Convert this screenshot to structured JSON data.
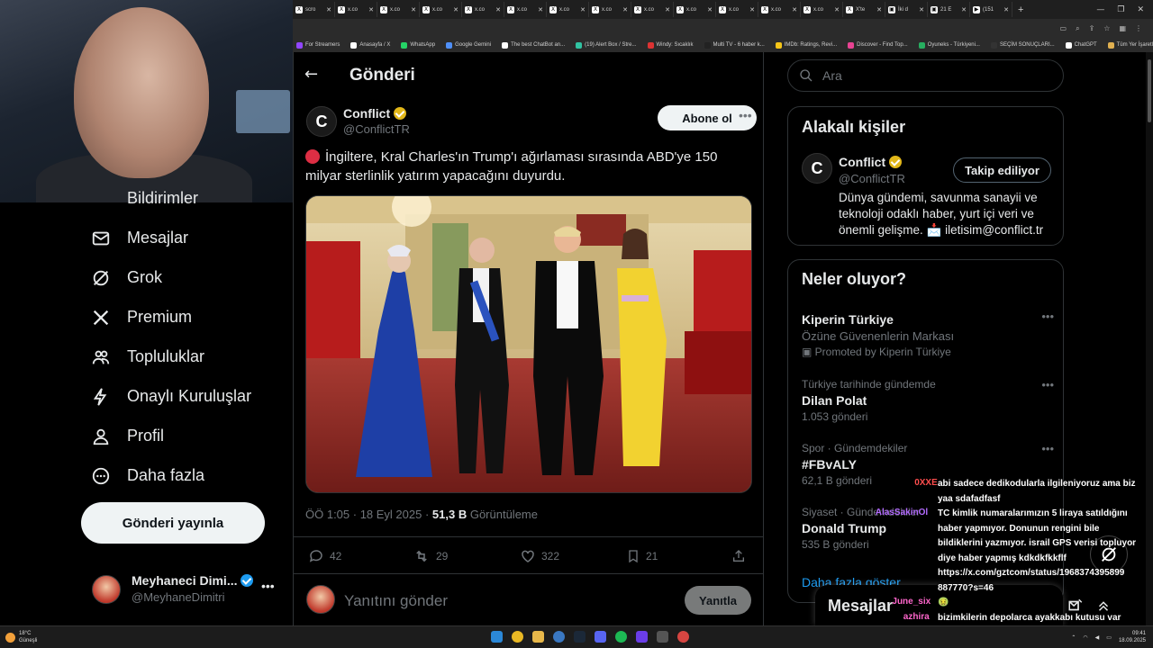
{
  "browser": {
    "tabs": [
      {
        "label": "scro",
        "fav": "X"
      },
      {
        "label": "x.co",
        "fav": "X"
      },
      {
        "label": "x.co",
        "fav": "X"
      },
      {
        "label": "x.co",
        "fav": "X"
      },
      {
        "label": "x.co",
        "fav": "X"
      },
      {
        "label": "x.co",
        "fav": "X"
      },
      {
        "label": "x.co",
        "fav": "X"
      },
      {
        "label": "x.co",
        "fav": "X"
      },
      {
        "label": "x.co",
        "fav": "X"
      },
      {
        "label": "x.co",
        "fav": "X"
      },
      {
        "label": "x.co",
        "fav": "X"
      },
      {
        "label": "x.co",
        "fav": "X"
      },
      {
        "label": "x.co",
        "fav": "X"
      },
      {
        "label": "X'te",
        "fav": "X"
      },
      {
        "label": "İki d",
        "fav": "▣"
      },
      {
        "label": "21 E",
        "fav": "▣"
      },
      {
        "label": "(151",
        "fav": "▶"
      }
    ],
    "bookmarks": [
      {
        "label": "For Streamers",
        "color": "#9146ff"
      },
      {
        "label": "Anasayfa / X",
        "color": "#ffffff"
      },
      {
        "label": "WhatsApp",
        "color": "#25d366"
      },
      {
        "label": "Google Gemini",
        "color": "#4f8ff7"
      },
      {
        "label": "The best ChatBot an...",
        "color": "#ffffff"
      },
      {
        "label": "(19) Alert Box / Stre...",
        "color": "#31c3a2"
      },
      {
        "label": "Windy: Sıcaklık",
        "color": "#d33"
      },
      {
        "label": "Multi TV - 6 haber k...",
        "color": "#222"
      },
      {
        "label": "IMDb: Ratings, Revi...",
        "color": "#f5c518"
      },
      {
        "label": "Discover - Find Top...",
        "color": "#e84393"
      },
      {
        "label": "Oyuneks - Türkiyeni...",
        "color": "#27ae60"
      },
      {
        "label": "SEÇİM SONUÇLARI...",
        "color": "#333"
      },
      {
        "label": "ChatGPT",
        "color": "#ffffff"
      },
      {
        "label": "Tüm Yer İşaretleri",
        "color": "#e0b050"
      }
    ]
  },
  "sidebar": {
    "items": [
      {
        "label": "Mesajlar",
        "icon": "envelope-icon"
      },
      {
        "label": "Grok",
        "icon": "grok-icon"
      },
      {
        "label": "Premium",
        "icon": "x-logo-icon"
      },
      {
        "label": "Topluluklar",
        "icon": "people-icon"
      },
      {
        "label": "Onaylı Kuruluşlar",
        "icon": "lightning-icon"
      },
      {
        "label": "Profil",
        "icon": "person-icon"
      },
      {
        "label": "Daha fazla",
        "icon": "more-circle-icon"
      }
    ],
    "partial_item": "Bildirimler",
    "post_button": "Gönderi yayınla",
    "profile": {
      "name": "Meyhaneci Dimi...",
      "handle": "@MeyhaneDimitri"
    }
  },
  "main": {
    "title": "Gönderi",
    "tweet": {
      "author": "Conflict",
      "handle": "@ConflictTR",
      "avatar_letter": "C",
      "follow_label": "Abone ol",
      "text": "İngiltere, Kral Charles'ın Trump'ı ağırlaması sırasında ABD'ye 150 milyar sterlinlik yatırım yapacağını duyurdu.",
      "time": "ÖÖ 1:05 · 18 Eyl 2025 · ",
      "views": "51,3 B",
      "views_label": " Görüntüleme",
      "replies": "42",
      "reposts": "29",
      "likes": "322",
      "bookmarks": "21"
    },
    "reply_placeholder": "Yanıtını gönder",
    "reply_button": "Yanıtla"
  },
  "right": {
    "search_placeholder": "Ara",
    "related": {
      "title": "Alakalı kişiler",
      "name": "Conflict",
      "handle": "@ConflictTR",
      "button": "Takip ediliyor",
      "bio": "Dünya gündemi, savunma sanayii ve teknoloji odaklı haber, yurt içi veri ve önemli gelişme. 📩 iletisim@conflict.tr"
    },
    "trends_title": "Neler oluyor?",
    "trends": [
      {
        "meta": "",
        "title": "Kiperin Türkiye",
        "sub": "Özüne Güvenenlerin Markası",
        "promo": "Promoted by Kiperin Türkiye"
      },
      {
        "meta": "Türkiye tarihinde gündemde",
        "title": "Dilan Polat",
        "sub": "1.053 gönderi"
      },
      {
        "meta": "Spor · Gündemdekiler",
        "title": "#FBvALY",
        "sub": "62,1 B gönderi"
      },
      {
        "meta": "Siyaset · Gündemdekiler",
        "title": "Donald Trump",
        "sub": "535 B gönderi"
      }
    ],
    "show_more": "Daha fazla göster",
    "messages_drawer": "Mesajlar"
  },
  "chat": [
    {
      "user": "0XXE",
      "user_color": "#ff4d4d",
      "text": "abi sadece dedikodularla ilgileniyoruz ama biz"
    },
    {
      "user": "",
      "user_color": "#ffffff",
      "text": "yaa sdafadfasf"
    },
    {
      "user": "AlasSakinOl",
      "user_color": "#b36bff",
      "text": "TC kimlik numaralarımızın 5 liraya satıldığını"
    },
    {
      "user": "",
      "user_color": "#ffffff",
      "text": "haber yapmıyor. Donunun rengini bile"
    },
    {
      "user": "",
      "user_color": "#ffffff",
      "text": "bildiklerini yazmıyor. israil GPS verisi topluyor"
    },
    {
      "user": "",
      "user_color": "#ffffff",
      "text": "diye haber yapmış kdkdkfkkflf"
    },
    {
      "user": "",
      "user_color": "#ffffff",
      "text": "https://x.com/gztcom/status/1968374395899"
    },
    {
      "user": "",
      "user_color": "#ffffff",
      "text": "887770?s=46"
    },
    {
      "user": "June_six",
      "user_color": "#ff66cc",
      "text": "🤢"
    },
    {
      "user": "azhira",
      "user_color": "#ff66cc",
      "text": "bizimkilerin depolarca ayakkabı kutusu var"
    },
    {
      "user": "",
      "user_color": "#ffffff",
      "text": "ama"
    }
  ],
  "taskbar": {
    "temp": "18°C",
    "weather": "Güneşli",
    "time": "09:41",
    "date": "18.09.2025"
  }
}
